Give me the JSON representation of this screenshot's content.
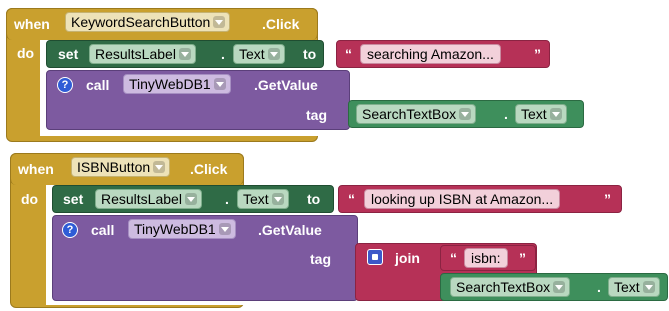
{
  "block1": {
    "when": "when",
    "event_component": "KeywordSearchButton",
    "event_name": ".Click",
    "do": "do",
    "set": "set",
    "set_component": "ResultsLabel",
    "dot": ".",
    "set_property": "Text",
    "to": "to",
    "string_value": "searching Amazon...",
    "call": "call",
    "call_component": "TinyWebDB1",
    "call_method": ".GetValue",
    "tag": "tag",
    "getter_component": "SearchTextBox",
    "getter_dot": ".",
    "getter_property": "Text"
  },
  "block2": {
    "when": "when",
    "event_component": "ISBNButton",
    "event_name": ".Click",
    "do": "do",
    "set": "set",
    "set_component": "ResultsLabel",
    "dot": ".",
    "set_property": "Text",
    "to": "to",
    "string_value": "looking up ISBN at Amazon...",
    "call": "call",
    "call_component": "TinyWebDB1",
    "call_method": ".GetValue",
    "tag": "tag",
    "join": "join",
    "join_string": "isbn:",
    "getter_component": "SearchTextBox",
    "getter_dot": ".",
    "getter_property": "Text"
  },
  "icons": {
    "question": "?",
    "quote_open": "“",
    "quote_close": "”"
  }
}
